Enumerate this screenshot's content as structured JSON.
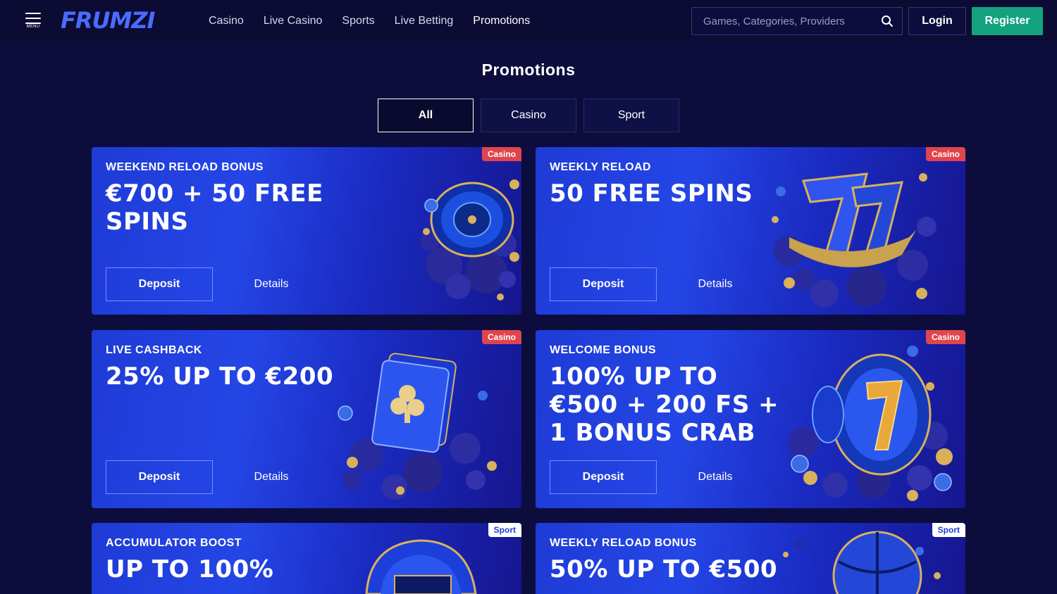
{
  "header": {
    "menu_label": "MENU",
    "logo_text": "FRUMZI",
    "nav": [
      "Casino",
      "Live Casino",
      "Sports",
      "Live Betting",
      "Promotions"
    ],
    "search_placeholder": "Games, Categories, Providers",
    "login_label": "Login",
    "register_label": "Register"
  },
  "page": {
    "title": "Promotions",
    "filters": [
      "All",
      "Casino",
      "Sport"
    ],
    "active_filter": "All"
  },
  "colors": {
    "background": "#0d0d3d",
    "register": "#12a37e",
    "casino_tag": "#e0454e",
    "card_blue": "#2446e6",
    "gold": "#d9b15a"
  },
  "cards": [
    {
      "kicker": "WEEKEND RELOAD BONUS",
      "headline": "€700 + 50 FREE SPINS",
      "tag": "Casino",
      "deposit": "Deposit",
      "details": "Details",
      "art": "roulette-icon"
    },
    {
      "kicker": "WEEKLY RELOAD",
      "headline": "50 FREE SPINS",
      "tag": "Casino",
      "deposit": "Deposit",
      "details": "Details",
      "art": "lucky-seven-icon"
    },
    {
      "kicker": "LIVE CASHBACK",
      "headline": "25% UP TO €200",
      "tag": "Casino",
      "deposit": "Deposit",
      "details": "Details",
      "art": "playing-cards-icon"
    },
    {
      "kicker": "WELCOME BONUS",
      "headline": "100% UP TO €500 + 200 FS + 1 BONUS CRAB",
      "tag": "Casino",
      "deposit": "Deposit",
      "details": "Details",
      "art": "slot-reel-icon"
    },
    {
      "kicker": "ACCUMULATOR BOOST",
      "headline": "UP TO 100%",
      "tag": "Sport",
      "art": "helmet-icon"
    },
    {
      "kicker": "WEEKLY RELOAD BONUS",
      "headline": "50% UP TO €500",
      "tag": "Sport",
      "art": "basketball-icon"
    }
  ]
}
